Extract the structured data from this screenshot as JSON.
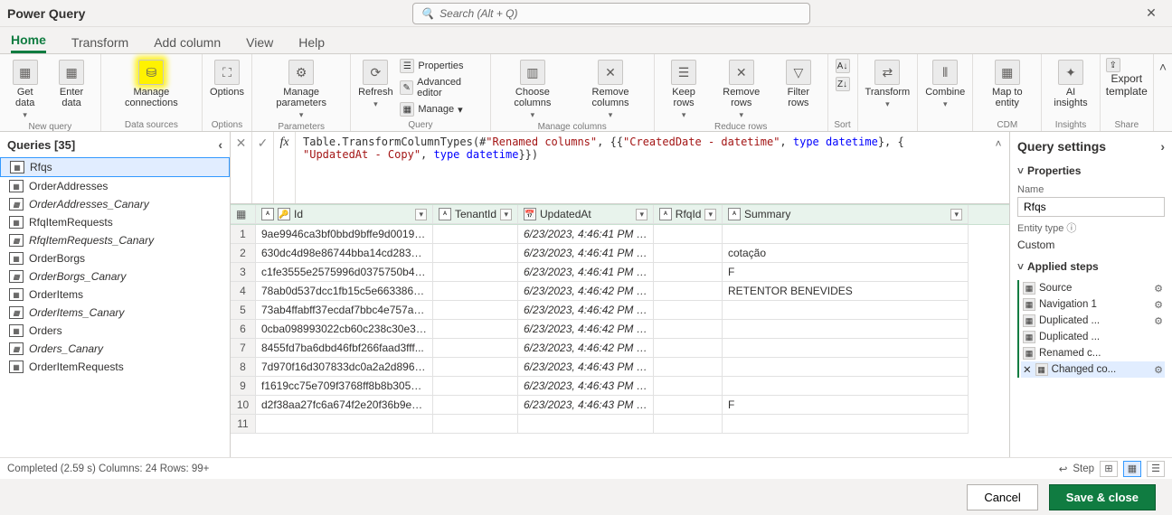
{
  "title": "Power Query",
  "search": {
    "placeholder": "Search (Alt + Q)"
  },
  "tabs": [
    "Home",
    "Transform",
    "Add column",
    "View",
    "Help"
  ],
  "active_tab": 0,
  "ribbon": {
    "new_query": {
      "get_data": "Get data",
      "enter_data": "Enter data",
      "label": "New query"
    },
    "data_sources": {
      "manage": "Manage connections",
      "label": "Data sources"
    },
    "options": {
      "options": "Options",
      "label": "Options"
    },
    "parameters": {
      "manage": "Manage parameters",
      "label": "Parameters"
    },
    "query": {
      "refresh": "Refresh",
      "properties": "Properties",
      "adv": "Advanced editor",
      "manage": "Manage",
      "label": "Query"
    },
    "manage_columns": {
      "choose": "Choose columns",
      "remove": "Remove columns",
      "label": "Manage columns"
    },
    "reduce_rows": {
      "keep": "Keep rows",
      "remove": "Remove rows",
      "filter": "Filter rows",
      "label": "Reduce rows"
    },
    "sort": {
      "label": "Sort"
    },
    "transform": {
      "transform": "Transform",
      "label": ""
    },
    "combine": {
      "combine": "Combine",
      "label": ""
    },
    "cdm": {
      "map": "Map to entity",
      "label": "CDM"
    },
    "insights": {
      "ai": "AI insights",
      "label": "Insights"
    },
    "share": {
      "export": "Export template",
      "label": "Share"
    }
  },
  "queries_header": "Queries [35]",
  "queries": [
    {
      "name": "Rfqs",
      "active": true
    },
    {
      "name": "OrderAddresses"
    },
    {
      "name": "OrderAddresses_Canary",
      "italic": true
    },
    {
      "name": "RfqItemRequests"
    },
    {
      "name": "RfqItemRequests_Canary",
      "italic": true
    },
    {
      "name": "OrderBorgs"
    },
    {
      "name": "OrderBorgs_Canary",
      "italic": true
    },
    {
      "name": "OrderItems"
    },
    {
      "name": "OrderItems_Canary",
      "italic": true
    },
    {
      "name": "Orders"
    },
    {
      "name": "Orders_Canary",
      "italic": true
    },
    {
      "name": "OrderItemRequests"
    }
  ],
  "formula": {
    "p1": "Table.TransformColumnTypes(#",
    "s1": "\"Renamed columns\"",
    "p2": ", {{",
    "s2": "\"CreatedDate - datetime\"",
    "p3": ", ",
    "k1": "type",
    "p4": " ",
    "k2": "datetime",
    "p5": "}, {",
    "s3": "\"UpdatedAt - Copy\"",
    "p6": ", ",
    "k3": "type",
    "p7": " ",
    "k4": "datetime",
    "p8": "}})"
  },
  "columns": [
    "Id",
    "TenantId",
    "UpdatedAt",
    "RfqId",
    "Summary"
  ],
  "rows": [
    {
      "n": 1,
      "id": "9ae9946ca3bf0bbd9bffe9d00192...",
      "upd": "6/23/2023, 4:46:41 PM +00:00",
      "sum": ""
    },
    {
      "n": 2,
      "id": "630dc4d98e86744bba14cd28389...",
      "upd": "6/23/2023, 4:46:41 PM +00:00",
      "sum": "cotação"
    },
    {
      "n": 3,
      "id": "c1fe3555e2575996d0375750b46...",
      "upd": "6/23/2023, 4:46:41 PM +00:00",
      "sum": "F"
    },
    {
      "n": 4,
      "id": "78ab0d537dcc1fb15c5e6633865...",
      "upd": "6/23/2023, 4:46:42 PM +00:00",
      "sum": "RETENTOR   BENEVIDES"
    },
    {
      "n": 5,
      "id": "73ab4ffabff37ecdaf7bbc4e757a3...",
      "upd": "6/23/2023, 4:46:42 PM +00:00",
      "sum": ""
    },
    {
      "n": 6,
      "id": "0cba098993022cb60c238c30e3a...",
      "upd": "6/23/2023, 4:46:42 PM +00:00",
      "sum": ""
    },
    {
      "n": 7,
      "id": "8455fd7ba6dbd46fbf266faad3fff...",
      "upd": "6/23/2023, 4:46:42 PM +00:00",
      "sum": ""
    },
    {
      "n": 8,
      "id": "7d970f16d307833dc0a2a2d8960...",
      "upd": "6/23/2023, 4:46:43 PM +00:00",
      "sum": ""
    },
    {
      "n": 9,
      "id": "f1619cc75e709f3768ff8b8b305cf...",
      "upd": "6/23/2023, 4:46:43 PM +00:00",
      "sum": ""
    },
    {
      "n": 10,
      "id": "d2f38aa27fc6a674f2e20f36b9e4e...",
      "upd": "6/23/2023, 4:46:43 PM +00:00",
      "sum": "F"
    },
    {
      "n": 11,
      "id": "",
      "upd": "",
      "sum": ""
    }
  ],
  "settings": {
    "title": "Query settings",
    "properties": "Properties",
    "name_label": "Name",
    "name_value": "Rfqs",
    "entity_label": "Entity type",
    "entity_value": "Custom",
    "applied_steps": "Applied steps",
    "steps": [
      {
        "label": "Source",
        "gear": true
      },
      {
        "label": "Navigation 1",
        "gear": true
      },
      {
        "label": "Duplicated ...",
        "gear": true
      },
      {
        "label": "Duplicated ..."
      },
      {
        "label": "Renamed c..."
      },
      {
        "label": "Changed co...",
        "gear": true,
        "active": true
      }
    ]
  },
  "status": {
    "left": "Completed (2.59 s)   Columns: 24   Rows: 99+",
    "step_label": "Step"
  },
  "footer": {
    "cancel": "Cancel",
    "save": "Save & close"
  }
}
